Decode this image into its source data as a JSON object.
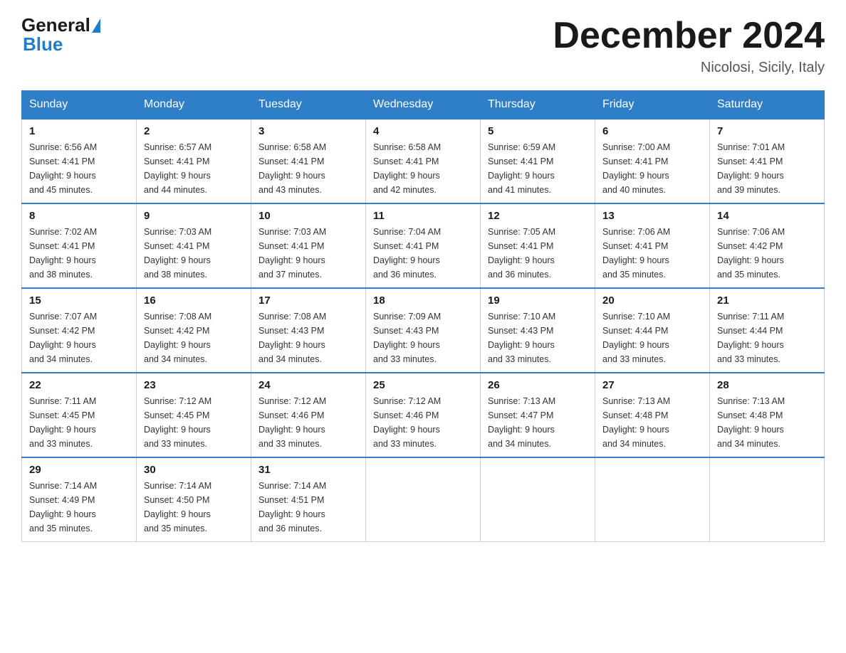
{
  "logo": {
    "general": "General",
    "blue": "Blue"
  },
  "title": "December 2024",
  "location": "Nicolosi, Sicily, Italy",
  "weekdays": [
    "Sunday",
    "Monday",
    "Tuesday",
    "Wednesday",
    "Thursday",
    "Friday",
    "Saturday"
  ],
  "weeks": [
    [
      {
        "day": "1",
        "sunrise": "6:56 AM",
        "sunset": "4:41 PM",
        "daylight": "9 hours and 45 minutes."
      },
      {
        "day": "2",
        "sunrise": "6:57 AM",
        "sunset": "4:41 PM",
        "daylight": "9 hours and 44 minutes."
      },
      {
        "day": "3",
        "sunrise": "6:58 AM",
        "sunset": "4:41 PM",
        "daylight": "9 hours and 43 minutes."
      },
      {
        "day": "4",
        "sunrise": "6:58 AM",
        "sunset": "4:41 PM",
        "daylight": "9 hours and 42 minutes."
      },
      {
        "day": "5",
        "sunrise": "6:59 AM",
        "sunset": "4:41 PM",
        "daylight": "9 hours and 41 minutes."
      },
      {
        "day": "6",
        "sunrise": "7:00 AM",
        "sunset": "4:41 PM",
        "daylight": "9 hours and 40 minutes."
      },
      {
        "day": "7",
        "sunrise": "7:01 AM",
        "sunset": "4:41 PM",
        "daylight": "9 hours and 39 minutes."
      }
    ],
    [
      {
        "day": "8",
        "sunrise": "7:02 AM",
        "sunset": "4:41 PM",
        "daylight": "9 hours and 38 minutes."
      },
      {
        "day": "9",
        "sunrise": "7:03 AM",
        "sunset": "4:41 PM",
        "daylight": "9 hours and 38 minutes."
      },
      {
        "day": "10",
        "sunrise": "7:03 AM",
        "sunset": "4:41 PM",
        "daylight": "9 hours and 37 minutes."
      },
      {
        "day": "11",
        "sunrise": "7:04 AM",
        "sunset": "4:41 PM",
        "daylight": "9 hours and 36 minutes."
      },
      {
        "day": "12",
        "sunrise": "7:05 AM",
        "sunset": "4:41 PM",
        "daylight": "9 hours and 36 minutes."
      },
      {
        "day": "13",
        "sunrise": "7:06 AM",
        "sunset": "4:41 PM",
        "daylight": "9 hours and 35 minutes."
      },
      {
        "day": "14",
        "sunrise": "7:06 AM",
        "sunset": "4:42 PM",
        "daylight": "9 hours and 35 minutes."
      }
    ],
    [
      {
        "day": "15",
        "sunrise": "7:07 AM",
        "sunset": "4:42 PM",
        "daylight": "9 hours and 34 minutes."
      },
      {
        "day": "16",
        "sunrise": "7:08 AM",
        "sunset": "4:42 PM",
        "daylight": "9 hours and 34 minutes."
      },
      {
        "day": "17",
        "sunrise": "7:08 AM",
        "sunset": "4:43 PM",
        "daylight": "9 hours and 34 minutes."
      },
      {
        "day": "18",
        "sunrise": "7:09 AM",
        "sunset": "4:43 PM",
        "daylight": "9 hours and 33 minutes."
      },
      {
        "day": "19",
        "sunrise": "7:10 AM",
        "sunset": "4:43 PM",
        "daylight": "9 hours and 33 minutes."
      },
      {
        "day": "20",
        "sunrise": "7:10 AM",
        "sunset": "4:44 PM",
        "daylight": "9 hours and 33 minutes."
      },
      {
        "day": "21",
        "sunrise": "7:11 AM",
        "sunset": "4:44 PM",
        "daylight": "9 hours and 33 minutes."
      }
    ],
    [
      {
        "day": "22",
        "sunrise": "7:11 AM",
        "sunset": "4:45 PM",
        "daylight": "9 hours and 33 minutes."
      },
      {
        "day": "23",
        "sunrise": "7:12 AM",
        "sunset": "4:45 PM",
        "daylight": "9 hours and 33 minutes."
      },
      {
        "day": "24",
        "sunrise": "7:12 AM",
        "sunset": "4:46 PM",
        "daylight": "9 hours and 33 minutes."
      },
      {
        "day": "25",
        "sunrise": "7:12 AM",
        "sunset": "4:46 PM",
        "daylight": "9 hours and 33 minutes."
      },
      {
        "day": "26",
        "sunrise": "7:13 AM",
        "sunset": "4:47 PM",
        "daylight": "9 hours and 34 minutes."
      },
      {
        "day": "27",
        "sunrise": "7:13 AM",
        "sunset": "4:48 PM",
        "daylight": "9 hours and 34 minutes."
      },
      {
        "day": "28",
        "sunrise": "7:13 AM",
        "sunset": "4:48 PM",
        "daylight": "9 hours and 34 minutes."
      }
    ],
    [
      {
        "day": "29",
        "sunrise": "7:14 AM",
        "sunset": "4:49 PM",
        "daylight": "9 hours and 35 minutes."
      },
      {
        "day": "30",
        "sunrise": "7:14 AM",
        "sunset": "4:50 PM",
        "daylight": "9 hours and 35 minutes."
      },
      {
        "day": "31",
        "sunrise": "7:14 AM",
        "sunset": "4:51 PM",
        "daylight": "9 hours and 36 minutes."
      },
      null,
      null,
      null,
      null
    ]
  ],
  "labels": {
    "sunrise": "Sunrise:",
    "sunset": "Sunset:",
    "daylight": "Daylight:"
  }
}
